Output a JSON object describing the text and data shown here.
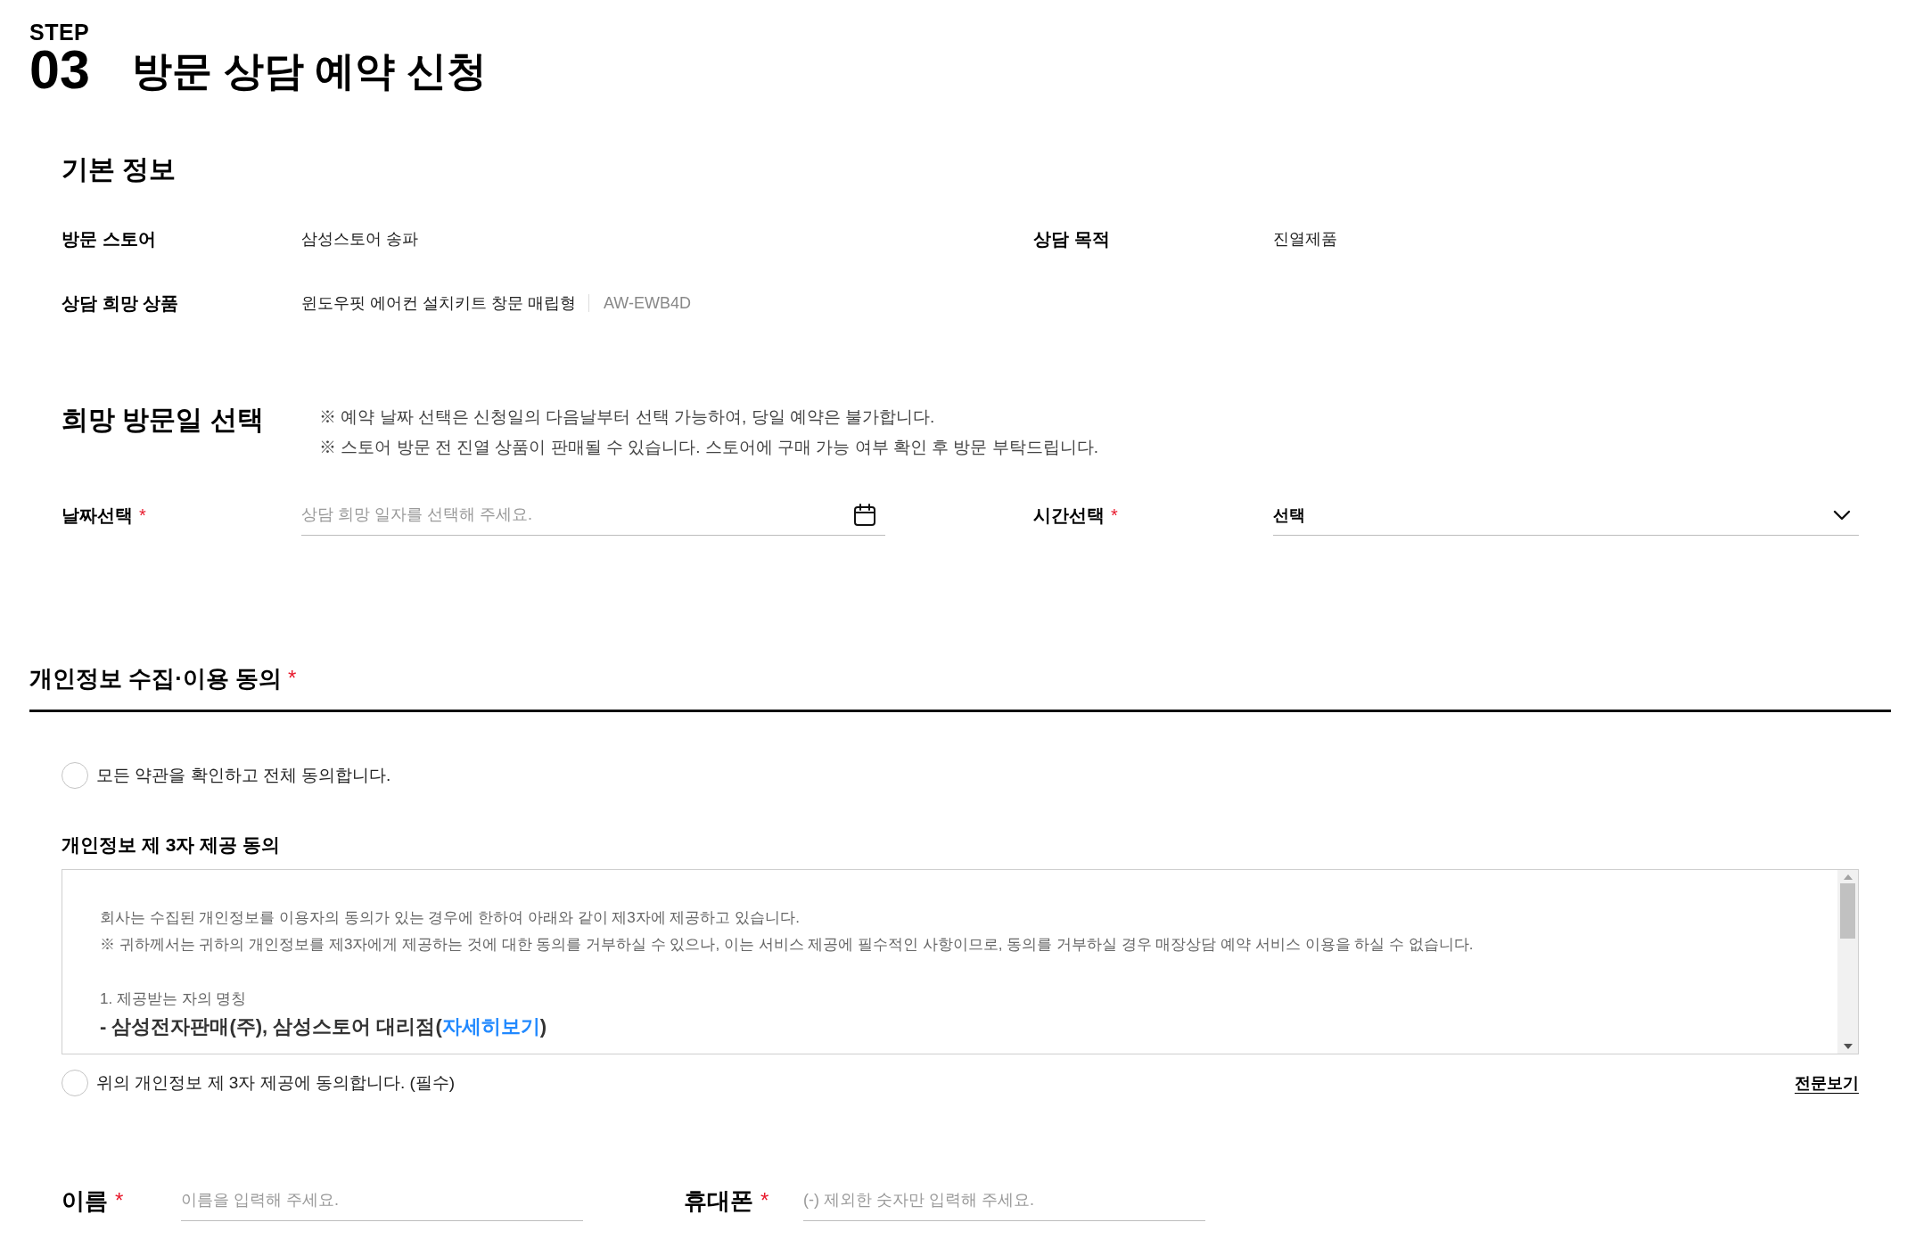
{
  "header": {
    "step_label": "STEP",
    "step_number": "03",
    "title": "방문 상담 예약 신청"
  },
  "basic_info": {
    "heading": "기본 정보",
    "fields": [
      {
        "label": "방문 스토어",
        "value": "삼성스토어 송파"
      },
      {
        "label": "상담 목적",
        "value": "진열제품"
      },
      {
        "label": "상담 희망 상품",
        "value": "윈도우핏 에어컨 설치키트 창문 매립형",
        "model_code": "AW-EWB4D"
      }
    ]
  },
  "visit_date": {
    "heading": "희망 방문일 선택",
    "notes": [
      "※ 예약 날짜 선택은 신청일의 다음날부터 선택 가능하여, 당일 예약은 불가합니다.",
      "※ 스토어 방문 전 진열 상품이 판매될 수 있습니다. 스토어에 구매 가능 여부 확인 후 방문 부탁드립니다."
    ],
    "fields": [
      {
        "kind": "date",
        "label": "날짜선택",
        "required_mark": "*",
        "placeholder": "상담 희망 일자를 선택해 주세요."
      },
      {
        "kind": "select",
        "label": "시간선택",
        "required_mark": "*",
        "value": "선택"
      }
    ]
  },
  "consent": {
    "heading": "개인정보 수집·이용 동의",
    "required_mark": "*",
    "agree_all": {
      "label": "모든 약관을 확인하고 전체 동의합니다.",
      "checked": false
    },
    "third_party": {
      "heading": "개인정보 제 3자 제공 동의",
      "terms": [
        {
          "kind": "paragraph",
          "text": "회사는 수집된 개인정보를 이용자의 동의가 있는 경우에 한하여 아래와 같이 제3자에 제공하고 있습니다."
        },
        {
          "kind": "paragraph",
          "text": "※ 귀하께서는 귀하의 개인정보를 제3자에게 제공하는 것에 대한 동의를 거부하실 수 있으나, 이는 서비스 제공에 필수적인 사항이므로, 동의를 거부하실 경우 매장상담 예약 서비스 이용을 하실 수 없습니다."
        },
        {
          "kind": "item_title",
          "text": "1. 제공받는 자의 명칭"
        },
        {
          "kind": "item_value",
          "text": "- 삼성전자판매(주), 삼성스토어 대리점(",
          "link": "자세히보기",
          "text_after": ")"
        }
      ],
      "agree": {
        "label": "위의 개인정보 제 3자 제공에 동의합니다. (필수)",
        "checked": false
      },
      "full_text_link": "전문보기"
    }
  },
  "contact": {
    "fields": [
      {
        "label": "이름",
        "required_mark": "*",
        "placeholder": "이름을 입력해 주세요."
      },
      {
        "label": "휴대폰",
        "required_mark": "*",
        "placeholder": "(-) 제외한 숫자만 입력해 주세요."
      }
    ]
  }
}
